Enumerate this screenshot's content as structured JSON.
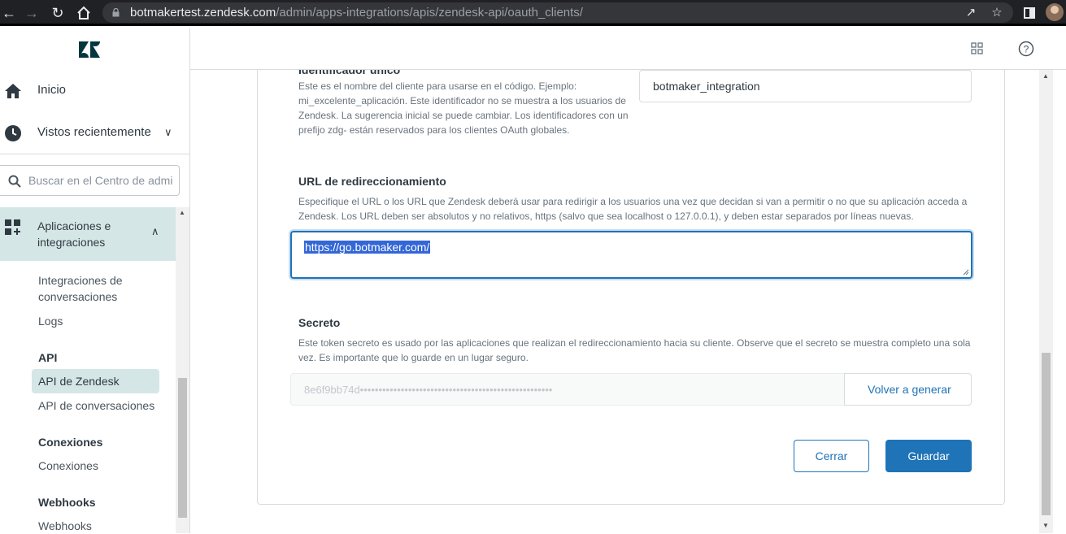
{
  "browser": {
    "url_host": "botmakertest.zendesk.com",
    "url_path": "/admin/apps-integrations/apis/zendesk-api/oauth_clients/"
  },
  "sidebar": {
    "home": "Inicio",
    "recent": "Vistos recientemente",
    "search_placeholder": "Buscar en el Centro de admi",
    "group": {
      "label_line1": "Aplicaciones e",
      "label_line2": "integraciones"
    },
    "items": {
      "integraciones_line1": "Integraciones de",
      "integraciones_line2": "conversaciones",
      "logs": "Logs",
      "api_head": "API",
      "api_zendesk": "API de Zendesk",
      "api_conversaciones": "API de conversaciones",
      "conexiones_head": "Conexiones",
      "conexiones": "Conexiones",
      "webhooks_head": "Webhooks",
      "webhooks": "Webhooks"
    }
  },
  "form": {
    "identifier_label": "Identificador único",
    "identifier_desc": [
      "Este es el nombre del cliente para usarse en el código. Ejemplo:",
      "mi_excelente_aplicación. Este identificador no se muestra a los usuarios de",
      "Zendesk. La sugerencia inicial se puede cambiar. Los identificadores con un",
      "prefijo zdg- están reservados para los clientes OAuth globales."
    ],
    "identifier_value": "botmaker_integration",
    "redirect_label": "URL de redireccionamiento",
    "redirect_desc": [
      "Especifique el URL o los URL que Zendesk deberá usar para redirigir a los usuarios una vez que decidan si van a permitir o no que su aplicación acceda a",
      "Zendesk. Los URL deben ser absolutos y no relativos, https (salvo que sea localhost o 127.0.0.1), y deben estar separados por líneas nuevas."
    ],
    "redirect_value": "https://go.botmaker.com/",
    "secret_label": "Secreto",
    "secret_desc": [
      "Este token secreto es usado por las aplicaciones que realizan el redireccionamiento hacia su cliente. Observe que el secreto se muestra completo una sola",
      "vez. Es importante que lo guarde en un lugar seguro."
    ],
    "secret_value": "8e6f9bb74d••••••••••••••••••••••••••••••••••••••••••••••••••••",
    "regenerate": "Volver a generar",
    "cancel": "Cerrar",
    "save": "Guardar"
  },
  "colors": {
    "accent": "#1f73b7",
    "active_nav": "#d5e6e6"
  }
}
